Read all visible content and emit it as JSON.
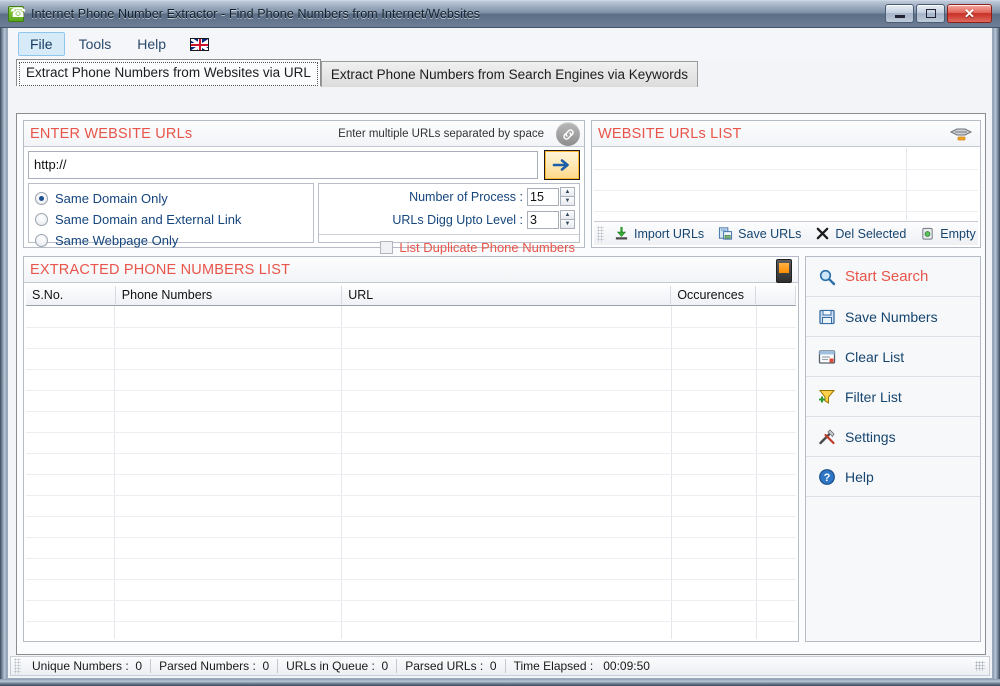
{
  "window": {
    "title": "Internet Phone Number Extractor - Find Phone Numbers from Internet/Websites",
    "app_icon": "phone-icon",
    "minimize": "—",
    "maximize": "□",
    "close": "✕"
  },
  "menubar": {
    "items": [
      {
        "label": "File",
        "active": true
      },
      {
        "label": "Tools",
        "active": false
      },
      {
        "label": "Help",
        "active": false
      }
    ],
    "flag": "uk-flag-icon"
  },
  "tabs": [
    {
      "label": "Extract Phone Numbers from Websites via URL",
      "selected": true
    },
    {
      "label": "Extract Phone Numbers from Search Engines via Keywords",
      "selected": false
    }
  ],
  "enter_urls": {
    "title": "ENTER WEBSITE URLs",
    "hint": "Enter multiple URLs separated by space",
    "icon": "link-icon",
    "url_value": "http://",
    "url_placeholder": "http://",
    "go_button": "go-arrow-button",
    "radios": [
      {
        "label": "Same Domain Only",
        "checked": true
      },
      {
        "label": "Same Domain and External Link",
        "checked": false
      },
      {
        "label": "Same Webpage Only",
        "checked": false
      }
    ],
    "number_of_process": {
      "label": "Number of Process :",
      "value": "15"
    },
    "urls_digg_level": {
      "label": "URLs Digg Upto Level :",
      "value": "3"
    },
    "duplicate_checkbox": {
      "label": "List Duplicate Phone Numbers",
      "checked": false
    }
  },
  "urls_list": {
    "title": "WEBSITE URLs LIST",
    "icon": "chain-icon",
    "rows": [],
    "toolbar": [
      {
        "label": "Import URLs",
        "icon": "import-icon"
      },
      {
        "label": "Save URLs",
        "icon": "save-icon"
      },
      {
        "label": "Del Selected",
        "icon": "delete-x-icon"
      },
      {
        "label": "Empty",
        "icon": "empty-bin-icon"
      }
    ]
  },
  "extracted": {
    "title": "EXTRACTED PHONE NUMBERS LIST",
    "icon": "mobile-phone-icon",
    "columns": [
      "S.No.",
      "Phone Numbers",
      "URL",
      "Occurences",
      ""
    ],
    "rows": []
  },
  "sidebar": {
    "buttons": [
      {
        "label": "Start Search",
        "icon": "magnifier-icon",
        "primary": true
      },
      {
        "label": "Save Numbers",
        "icon": "floppy-disk-icon",
        "primary": false
      },
      {
        "label": "Clear List",
        "icon": "clear-list-icon",
        "primary": false
      },
      {
        "label": "Filter List",
        "icon": "filter-funnel-icon",
        "primary": false
      },
      {
        "label": "Settings",
        "icon": "tools-icon",
        "primary": false
      },
      {
        "label": "Help",
        "icon": "question-mark-icon",
        "primary": false
      }
    ]
  },
  "statusbar": {
    "cells": [
      {
        "label": "Unique Numbers :",
        "value": "0"
      },
      {
        "label": "Parsed Numbers :",
        "value": "0"
      },
      {
        "label": "URLs in Queue :",
        "value": "0"
      },
      {
        "label": "Parsed URLs :",
        "value": "0"
      },
      {
        "label": "Time Elapsed :",
        "value": "00:09:50"
      }
    ]
  },
  "colors": {
    "accent_red": "#e8554a",
    "link_blue": "#16456f",
    "title_bar": "#7d8fa5"
  }
}
